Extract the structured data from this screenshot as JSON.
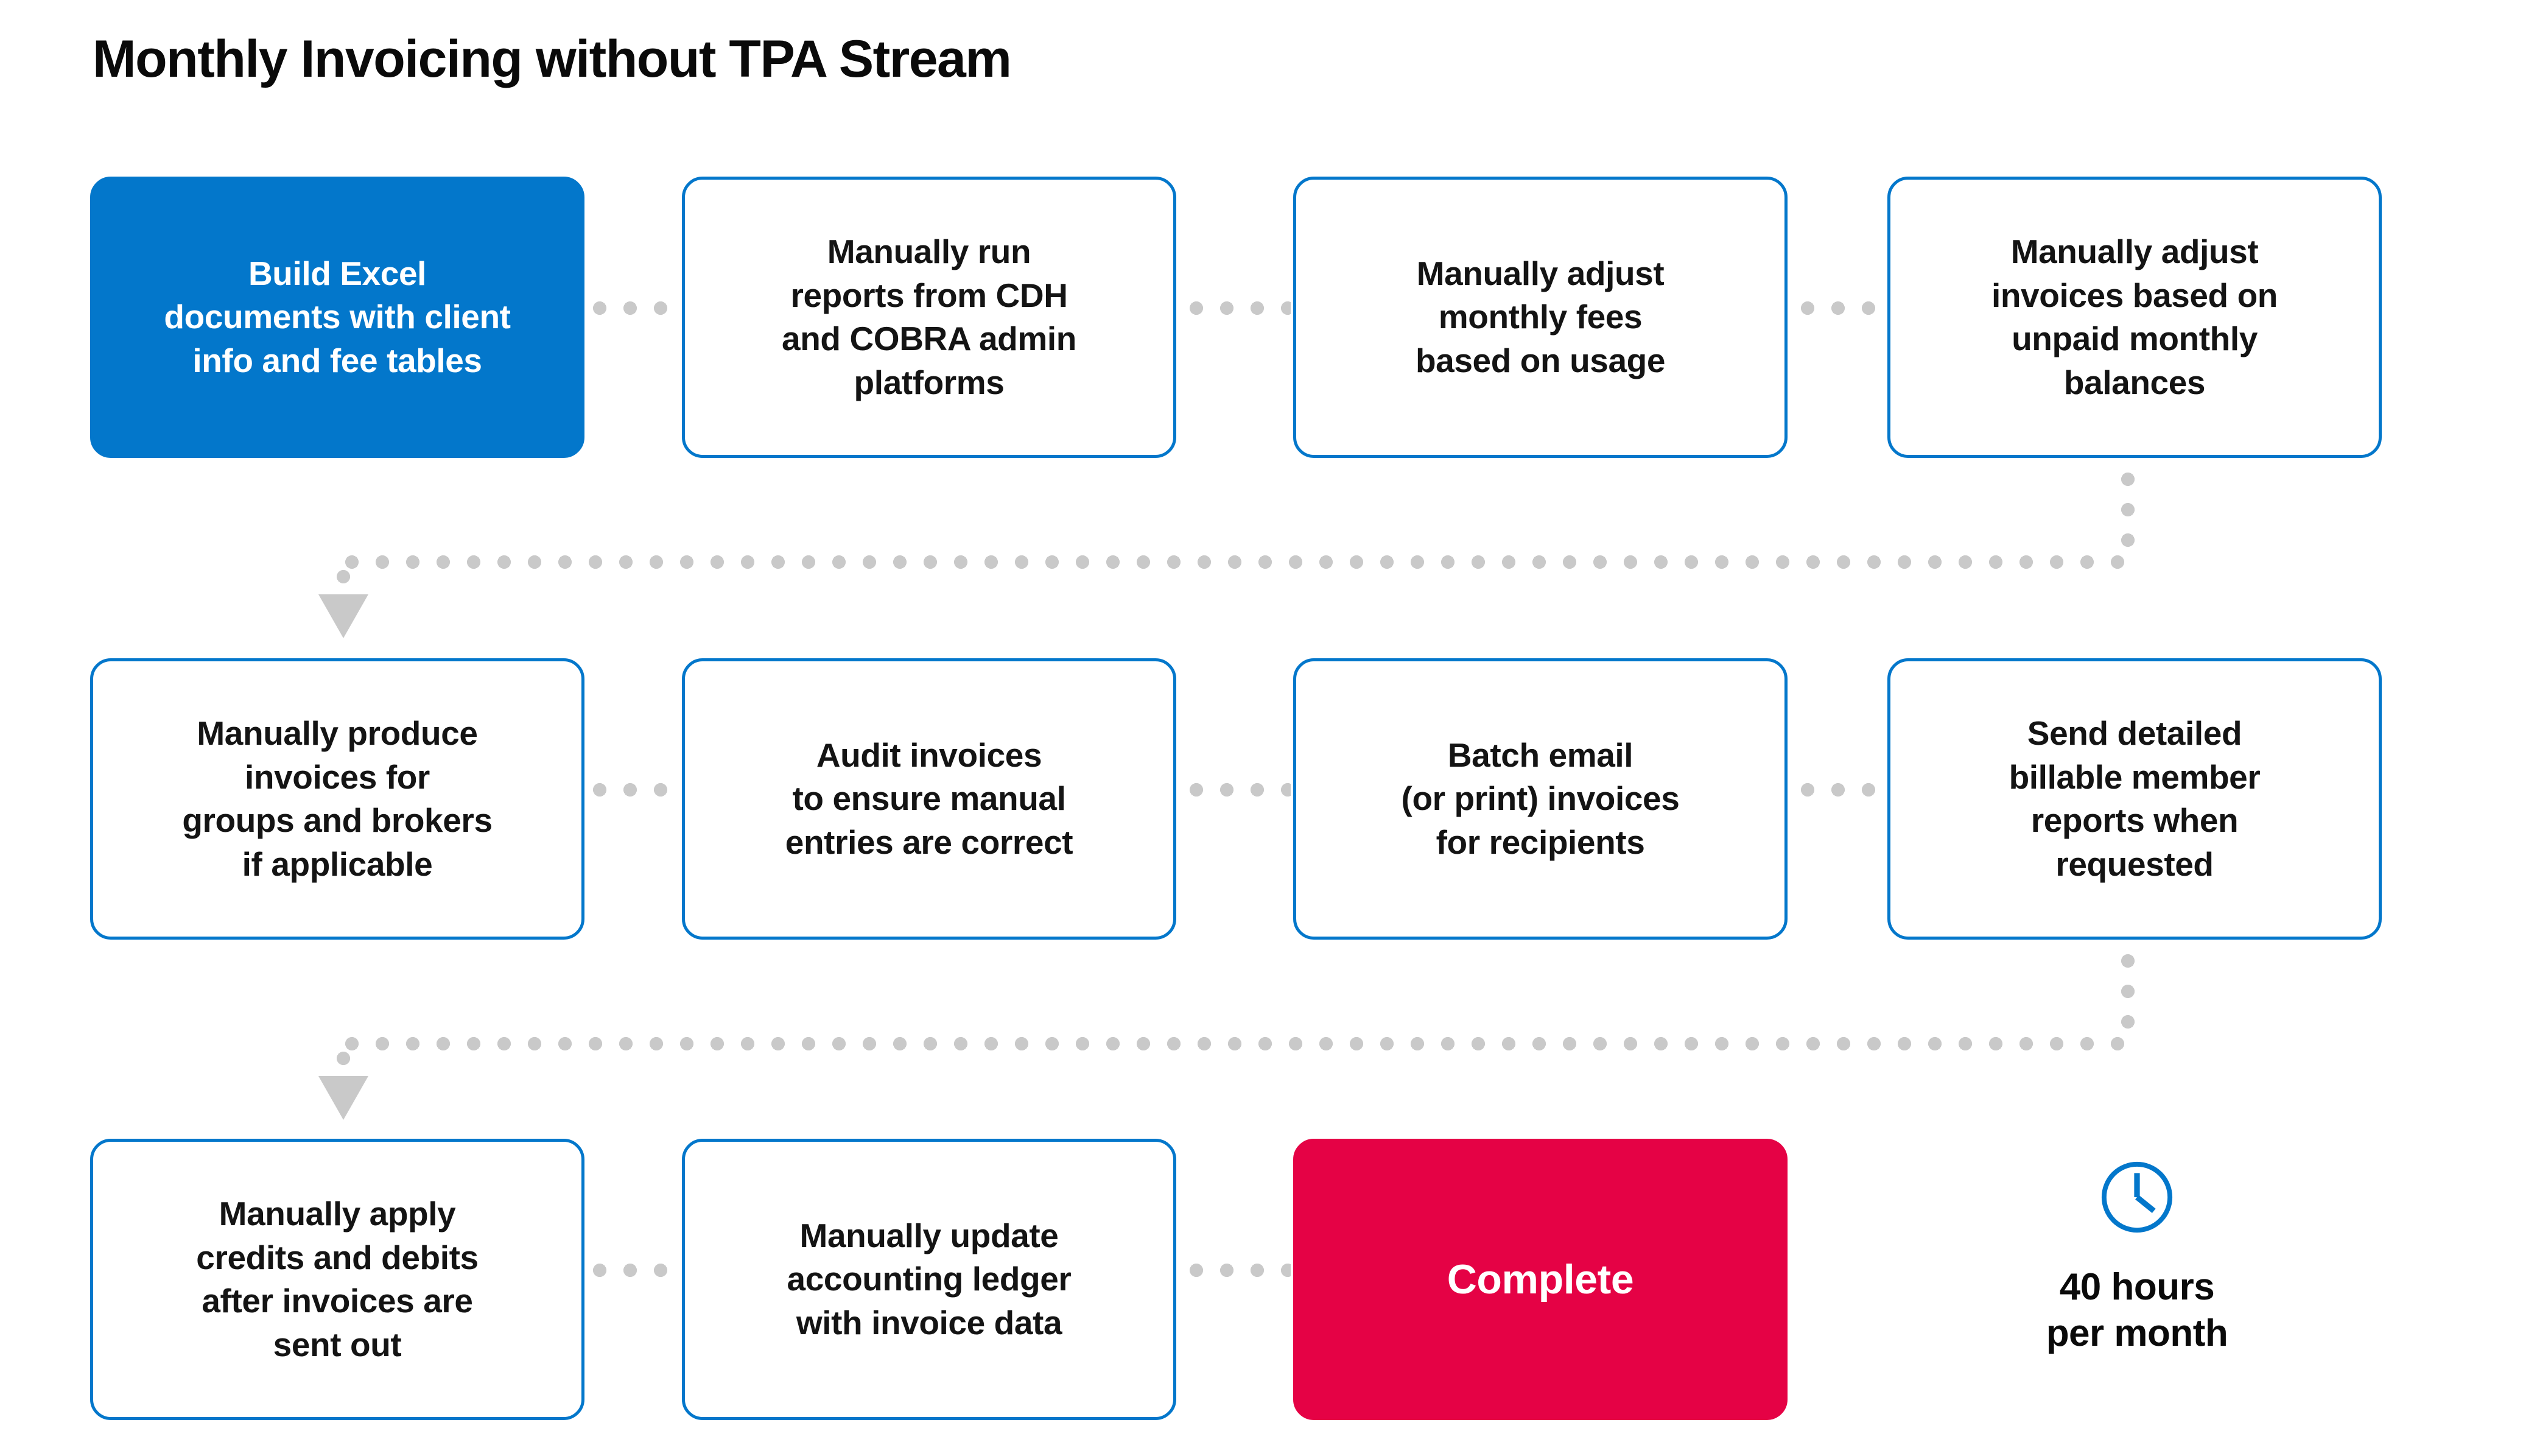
{
  "title": "Monthly Invoicing without TPA Stream",
  "colors": {
    "accent_blue": "#0377CB",
    "accent_red": "#E50245",
    "connector_gray": "#C9C9C9",
    "text_dark": "#141414",
    "background": "#FFFFFF"
  },
  "flow": {
    "rows": [
      {
        "nodes": [
          {
            "id": "build-excel",
            "label": "Build Excel\ndocuments with client\ninfo and fee tables",
            "style": "filled-blue"
          },
          {
            "id": "run-reports",
            "label": "Manually run\nreports from CDH\nand COBRA admin\nplatforms",
            "style": "outline"
          },
          {
            "id": "adjust-fees",
            "label": "Manually adjust\nmonthly fees\nbased on usage",
            "style": "outline"
          },
          {
            "id": "adjust-invoices",
            "label": "Manually adjust\ninvoices based on\nunpaid monthly\nbalances",
            "style": "outline"
          }
        ]
      },
      {
        "nodes": [
          {
            "id": "produce-invoices",
            "label": "Manually produce\ninvoices for\ngroups and brokers\nif applicable",
            "style": "outline"
          },
          {
            "id": "audit-invoices",
            "label": "Audit invoices\nto ensure manual\nentries are correct",
            "style": "outline"
          },
          {
            "id": "batch-email",
            "label": "Batch email\n(or print) invoices\nfor recipients",
            "style": "outline"
          },
          {
            "id": "send-reports",
            "label": "Send detailed\nbillable member\nreports when\nrequested",
            "style": "outline"
          }
        ]
      },
      {
        "nodes": [
          {
            "id": "apply-credits",
            "label": "Manually apply\ncredits and debits\nafter invoices are\nsent out",
            "style": "outline"
          },
          {
            "id": "update-ledger",
            "label": "Manually update\naccounting ledger\nwith invoice data",
            "style": "outline"
          },
          {
            "id": "complete",
            "label": "Complete",
            "style": "filled-red"
          }
        ]
      }
    ]
  },
  "summary": {
    "icon": "clock-icon",
    "hours_label": "40 hours\nper month"
  }
}
